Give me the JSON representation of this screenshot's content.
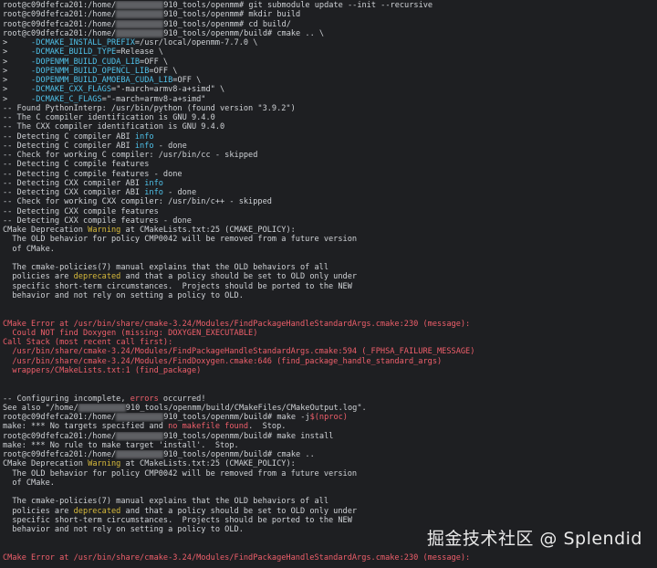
{
  "lines": [
    [
      [
        "root@c09dfefca201:/home/",
        ""
      ],
      [
        "REDACT",
        "redact"
      ],
      [
        "910_tools/openmm# git submodule update --init --recursive",
        ""
      ]
    ],
    [
      [
        "root@c09dfefca201:/home/",
        ""
      ],
      [
        "REDACT",
        "redact"
      ],
      [
        "910_tools/openmm# mkdir build",
        ""
      ]
    ],
    [
      [
        "root@c09dfefca201:/home/",
        ""
      ],
      [
        "REDACT",
        "redact"
      ],
      [
        "910_tools/openmm# cd build/",
        ""
      ]
    ],
    [
      [
        "root@c09dfefca201:/home/",
        ""
      ],
      [
        "REDACT",
        "redact"
      ],
      [
        "910_tools/openmm/build# cmake .. \\",
        ""
      ]
    ],
    [
      [
        ">     ",
        ""
      ],
      [
        "-DCMAKE_INSTALL_PREFIX",
        "cyan"
      ],
      [
        "=/usr/local/openmm-7.7.0 \\",
        ""
      ]
    ],
    [
      [
        ">     ",
        ""
      ],
      [
        "-DCMAKE_BUILD_TYPE",
        "cyan"
      ],
      [
        "=Release \\",
        ""
      ]
    ],
    [
      [
        ">     ",
        ""
      ],
      [
        "-DOPENMM_BUILD_CUDA_LIB",
        "cyan"
      ],
      [
        "=OFF \\",
        ""
      ]
    ],
    [
      [
        ">     ",
        ""
      ],
      [
        "-DOPENMM_BUILD_OPENCL_LIB",
        "cyan"
      ],
      [
        "=OFF \\",
        ""
      ]
    ],
    [
      [
        ">     ",
        ""
      ],
      [
        "-DOPENMM_BUILD_AMOEBA_CUDA_LIB",
        "cyan"
      ],
      [
        "=OFF \\",
        ""
      ]
    ],
    [
      [
        ">     ",
        ""
      ],
      [
        "-DCMAKE_CXX_FLAGS",
        "cyan"
      ],
      [
        "=\"-march=armv8-a+simd\" \\",
        ""
      ]
    ],
    [
      [
        ">     ",
        ""
      ],
      [
        "-DCMAKE_C_FLAGS",
        "cyan"
      ],
      [
        "=\"-march=armv8-a+simd\"",
        ""
      ]
    ],
    [
      [
        "-- Found PythonInterp: /usr/bin/python (found version \"3.9.2\")",
        ""
      ]
    ],
    [
      [
        "-- The C compiler identification is GNU 9.4.0",
        ""
      ]
    ],
    [
      [
        "-- The CXX compiler identification is GNU 9.4.0",
        ""
      ]
    ],
    [
      [
        "-- Detecting C compiler ABI ",
        ""
      ],
      [
        "info",
        "cyan"
      ]
    ],
    [
      [
        "-- Detecting C compiler ABI ",
        ""
      ],
      [
        "info",
        "cyan"
      ],
      [
        " - done",
        ""
      ]
    ],
    [
      [
        "-- Check for working C compiler: /usr/bin/cc - skipped",
        ""
      ]
    ],
    [
      [
        "-- Detecting C compile features",
        ""
      ]
    ],
    [
      [
        "-- Detecting C compile features - done",
        ""
      ]
    ],
    [
      [
        "-- Detecting CXX compiler ABI ",
        ""
      ],
      [
        "info",
        "cyan"
      ]
    ],
    [
      [
        "-- Detecting CXX compiler ABI ",
        ""
      ],
      [
        "info",
        "cyan"
      ],
      [
        " - done",
        ""
      ]
    ],
    [
      [
        "-- Check for working CXX compiler: /usr/bin/c++ - skipped",
        ""
      ]
    ],
    [
      [
        "-- Detecting CXX compile features",
        ""
      ]
    ],
    [
      [
        "-- Detecting CXX compile features - done",
        ""
      ]
    ],
    [
      [
        "CMake Deprecation ",
        ""
      ],
      [
        "Warning",
        "yellow"
      ],
      [
        " at CMakeLists.txt:25 (CMAKE_POLICY):",
        ""
      ]
    ],
    [
      [
        "  The OLD behavior for policy CMP0042 will be removed from a future version",
        ""
      ]
    ],
    [
      [
        "  of CMake.",
        ""
      ]
    ],
    [
      [
        "",
        ""
      ]
    ],
    [
      [
        "  The cmake-policies(7) manual explains that the OLD behaviors of all",
        ""
      ]
    ],
    [
      [
        "  policies are ",
        ""
      ],
      [
        "deprecated",
        "yellow"
      ],
      [
        " and that a policy should be set to OLD only under",
        ""
      ]
    ],
    [
      [
        "  specific short-term circumstances.  Projects should be ported to the NEW",
        ""
      ]
    ],
    [
      [
        "  behavior and not rely on setting a policy to OLD.",
        ""
      ]
    ],
    [
      [
        "",
        ""
      ]
    ],
    [
      [
        "",
        ""
      ]
    ],
    [
      [
        "CMake Error at /usr/bin/share/cmake-3.24/Modules/FindPackageHandleStandardArgs.cmake:230 (message):",
        "red"
      ]
    ],
    [
      [
        "  Could NOT find Doxygen (missing: DOXYGEN_EXECUTABLE)",
        "red"
      ]
    ],
    [
      [
        "Call Stack (most recent call first):",
        "red"
      ]
    ],
    [
      [
        "  /usr/bin/share/cmake-3.24/Modules/FindPackageHandleStandardArgs.cmake:594 (_FPHSA_FAILURE_MESSAGE)",
        "red"
      ]
    ],
    [
      [
        "  /usr/bin/share/cmake-3.24/Modules/FindDoxygen.cmake:646 (find_package_handle_standard_args)",
        "red"
      ]
    ],
    [
      [
        "  wrappers/CMakeLists.txt:1 (find_package)",
        "red"
      ]
    ],
    [
      [
        "",
        ""
      ]
    ],
    [
      [
        "",
        ""
      ]
    ],
    [
      [
        "-- Configuring incomplete, ",
        ""
      ],
      [
        "errors",
        "red"
      ],
      [
        " occurred!",
        ""
      ]
    ],
    [
      [
        "See also \"/home/",
        ""
      ],
      [
        "REDACT",
        "redact"
      ],
      [
        "910_tools/openmm/build/CMakeFiles/CMakeOutput.log\".",
        ""
      ]
    ],
    [
      [
        "root@c09dfefca201:/home/",
        ""
      ],
      [
        "REDACT",
        "redact"
      ],
      [
        "910_tools/openmm/build# make -j",
        ""
      ],
      [
        "$(nproc)",
        "red"
      ]
    ],
    [
      [
        "make: *** No targets specified and ",
        ""
      ],
      [
        "no makefile found",
        "red"
      ],
      [
        ".  Stop.",
        ""
      ]
    ],
    [
      [
        "root@c09dfefca201:/home/",
        ""
      ],
      [
        "REDACT",
        "redact"
      ],
      [
        "910_tools/openmm/build# make install",
        ""
      ]
    ],
    [
      [
        "make: *** No rule to make target 'install'.  Stop.",
        ""
      ]
    ],
    [
      [
        "root@c09dfefca201:/home/",
        ""
      ],
      [
        "REDACT",
        "redact"
      ],
      [
        "910_tools/openmm/build# cmake ..",
        ""
      ]
    ],
    [
      [
        "CMake Deprecation ",
        ""
      ],
      [
        "Warning",
        "yellow"
      ],
      [
        " at CMakeLists.txt:25 (CMAKE_POLICY):",
        ""
      ]
    ],
    [
      [
        "  The OLD behavior for policy CMP0042 will be removed from a future version",
        ""
      ]
    ],
    [
      [
        "  of CMake.",
        ""
      ]
    ],
    [
      [
        "",
        ""
      ]
    ],
    [
      [
        "  The cmake-policies(7) manual explains that the OLD behaviors of all",
        ""
      ]
    ],
    [
      [
        "  policies are ",
        ""
      ],
      [
        "deprecated",
        "yellow"
      ],
      [
        " and that a policy should be set to OLD only under",
        ""
      ]
    ],
    [
      [
        "  specific short-term circumstances.  Projects should be ported to the NEW",
        ""
      ]
    ],
    [
      [
        "  behavior and not rely on setting a policy to OLD.",
        ""
      ]
    ],
    [
      [
        "",
        ""
      ]
    ],
    [
      [
        "",
        ""
      ]
    ],
    [
      [
        "CMake Error at /usr/bin/share/cmake-3.24/Modules/FindPackageHandleStandardArgs.cmake:230 (message):",
        "red"
      ]
    ]
  ],
  "watermark": "掘金技术社区 @ Splendid",
  "colors": {
    "background": "#1e1f22",
    "text": "#cfd2d6",
    "cyan": "#4fc1e9",
    "yellow": "#d7ba3b",
    "red": "#ef5f6b"
  }
}
